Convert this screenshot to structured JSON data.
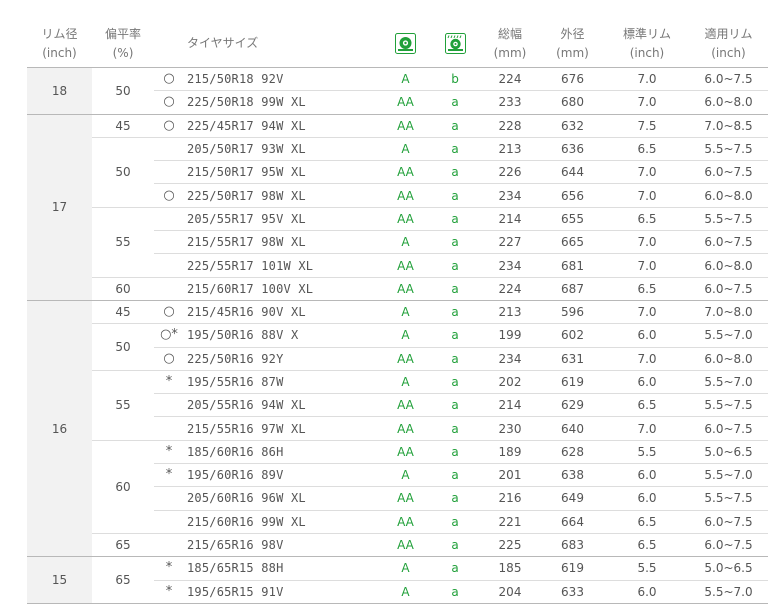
{
  "header": {
    "rim_diameter": "リム径",
    "rim_diameter_unit": "(inch)",
    "aspect_ratio": "偏平率",
    "aspect_ratio_unit": "(%)",
    "tire_size": "タイヤサイズ",
    "width": "総幅",
    "width_unit": "(mm)",
    "outer_diameter": "外径",
    "outer_diameter_unit": "(mm)",
    "standard_rim": "標準リム",
    "standard_rim_unit": "(inch)",
    "applicable_rim": "適用リム",
    "applicable_rim_unit": "(inch)",
    "rolling_icon": "tire-rolling-resistance-icon",
    "wet_grip_icon": "tire-wet-grip-icon"
  },
  "colors": {
    "grade": "#21a03a",
    "header_text": "#777777",
    "rim_bg": "#f2f2f2"
  },
  "groups": [
    {
      "rim": "18",
      "aspects": [
        {
          "aspect": "50",
          "rows": [
            {
              "mark": "○",
              "size": "215/50R18 92V",
              "rolling": "A",
              "wet": "b",
              "width": "224",
              "diameter": "676",
              "std_rim": "7.0",
              "app_rim": "6.0~7.5"
            },
            {
              "mark": "○",
              "size": "225/50R18 99W XL",
              "rolling": "AA",
              "wet": "a",
              "width": "233",
              "diameter": "680",
              "std_rim": "7.0",
              "app_rim": "6.0~8.0"
            }
          ]
        }
      ]
    },
    {
      "rim": "17",
      "aspects": [
        {
          "aspect": "45",
          "rows": [
            {
              "mark": "○",
              "size": "225/45R17 94W XL",
              "rolling": "AA",
              "wet": "a",
              "width": "228",
              "diameter": "632",
              "std_rim": "7.5",
              "app_rim": "7.0~8.5"
            }
          ]
        },
        {
          "aspect": "50",
          "rows": [
            {
              "mark": "",
              "size": "205/50R17 93W XL",
              "rolling": "A",
              "wet": "a",
              "width": "213",
              "diameter": "636",
              "std_rim": "6.5",
              "app_rim": "5.5~7.5"
            },
            {
              "mark": "",
              "size": "215/50R17 95W XL",
              "rolling": "AA",
              "wet": "a",
              "width": "226",
              "diameter": "644",
              "std_rim": "7.0",
              "app_rim": "6.0~7.5"
            },
            {
              "mark": "○",
              "size": "225/50R17 98W XL",
              "rolling": "AA",
              "wet": "a",
              "width": "234",
              "diameter": "656",
              "std_rim": "7.0",
              "app_rim": "6.0~8.0"
            }
          ]
        },
        {
          "aspect": "55",
          "rows": [
            {
              "mark": "",
              "size": "205/55R17 95V XL",
              "rolling": "AA",
              "wet": "a",
              "width": "214",
              "diameter": "655",
              "std_rim": "6.5",
              "app_rim": "5.5~7.5"
            },
            {
              "mark": "",
              "size": "215/55R17 98W XL",
              "rolling": "A",
              "wet": "a",
              "width": "227",
              "diameter": "665",
              "std_rim": "7.0",
              "app_rim": "6.0~7.5"
            },
            {
              "mark": "",
              "size": "225/55R17 101W XL",
              "rolling": "AA",
              "wet": "a",
              "width": "234",
              "diameter": "681",
              "std_rim": "7.0",
              "app_rim": "6.0~8.0"
            }
          ]
        },
        {
          "aspect": "60",
          "rows": [
            {
              "mark": "",
              "size": "215/60R17 100V XL",
              "rolling": "AA",
              "wet": "a",
              "width": "224",
              "diameter": "687",
              "std_rim": "6.5",
              "app_rim": "6.0~7.5"
            }
          ]
        }
      ]
    },
    {
      "rim": "16",
      "aspects": [
        {
          "aspect": "45",
          "rows": [
            {
              "mark": "○",
              "size": "215/45R16 90V XL",
              "rolling": "A",
              "wet": "a",
              "width": "213",
              "diameter": "596",
              "std_rim": "7.0",
              "app_rim": "7.0~8.0"
            }
          ]
        },
        {
          "aspect": "50",
          "rows": [
            {
              "mark": "○*",
              "size": "195/50R16 88V X",
              "rolling": "A",
              "wet": "a",
              "width": "199",
              "diameter": "602",
              "std_rim": "6.0",
              "app_rim": "5.5~7.0"
            },
            {
              "mark": "○",
              "size": "225/50R16 92Y",
              "rolling": "AA",
              "wet": "a",
              "width": "234",
              "diameter": "631",
              "std_rim": "7.0",
              "app_rim": "6.0~8.0"
            }
          ]
        },
        {
          "aspect": "55",
          "rows": [
            {
              "mark": "*",
              "size": "195/55R16 87W",
              "rolling": "A",
              "wet": "a",
              "width": "202",
              "diameter": "619",
              "std_rim": "6.0",
              "app_rim": "5.5~7.0"
            },
            {
              "mark": "",
              "size": "205/55R16 94W XL",
              "rolling": "AA",
              "wet": "a",
              "width": "214",
              "diameter": "629",
              "std_rim": "6.5",
              "app_rim": "5.5~7.5"
            },
            {
              "mark": "",
              "size": "215/55R16 97W XL",
              "rolling": "AA",
              "wet": "a",
              "width": "230",
              "diameter": "640",
              "std_rim": "7.0",
              "app_rim": "6.0~7.5"
            }
          ]
        },
        {
          "aspect": "60",
          "rows": [
            {
              "mark": "*",
              "size": "185/60R16 86H",
              "rolling": "AA",
              "wet": "a",
              "width": "189",
              "diameter": "628",
              "std_rim": "5.5",
              "app_rim": "5.0~6.5"
            },
            {
              "mark": "*",
              "size": "195/60R16 89V",
              "rolling": "A",
              "wet": "a",
              "width": "201",
              "diameter": "638",
              "std_rim": "6.0",
              "app_rim": "5.5~7.0"
            },
            {
              "mark": "",
              "size": "205/60R16 96W XL",
              "rolling": "AA",
              "wet": "a",
              "width": "216",
              "diameter": "649",
              "std_rim": "6.0",
              "app_rim": "5.5~7.5"
            },
            {
              "mark": "",
              "size": "215/60R16 99W XL",
              "rolling": "AA",
              "wet": "a",
              "width": "221",
              "diameter": "664",
              "std_rim": "6.5",
              "app_rim": "6.0~7.5"
            }
          ]
        },
        {
          "aspect": "65",
          "rows": [
            {
              "mark": "",
              "size": "215/65R16 98V",
              "rolling": "AA",
              "wet": "a",
              "width": "225",
              "diameter": "683",
              "std_rim": "6.5",
              "app_rim": "6.0~7.5"
            }
          ]
        }
      ]
    },
    {
      "rim": "15",
      "aspects": [
        {
          "aspect": "65",
          "rows": [
            {
              "mark": "*",
              "size": "185/65R15 88H",
              "rolling": "A",
              "wet": "a",
              "width": "185",
              "diameter": "619",
              "std_rim": "5.5",
              "app_rim": "5.0~6.5"
            },
            {
              "mark": "*",
              "size": "195/65R15 91V",
              "rolling": "A",
              "wet": "a",
              "width": "204",
              "diameter": "633",
              "std_rim": "6.0",
              "app_rim": "5.5~7.0"
            }
          ]
        }
      ]
    }
  ]
}
